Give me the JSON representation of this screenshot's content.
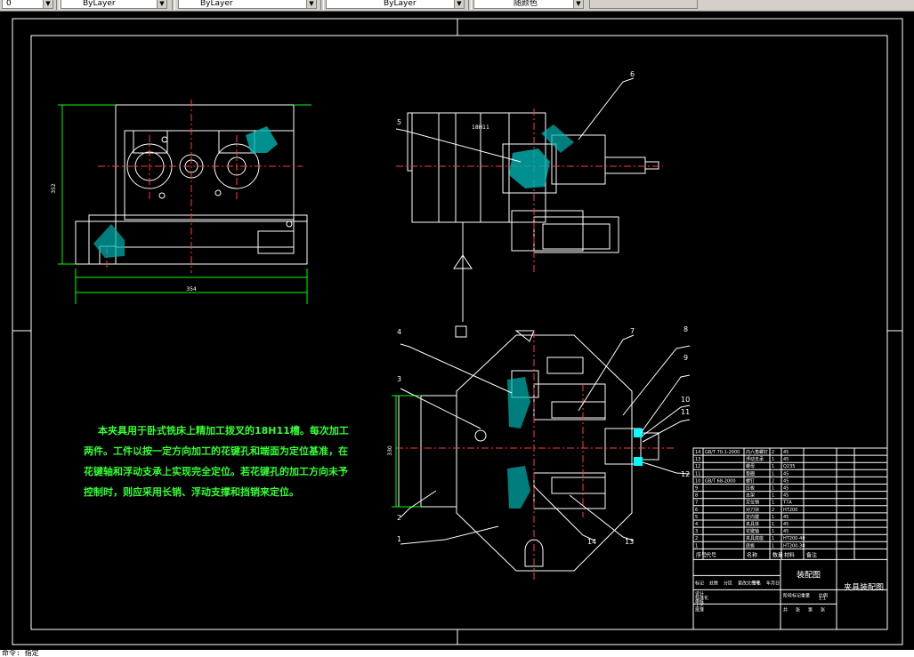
{
  "toolbar": {
    "layer_combo": "0",
    "color_combo": "ByLayer",
    "linetype_combo": "ByLayer",
    "lineweight_combo": "ByLayer",
    "plotstyle_combo": "随颜色"
  },
  "drawing": {
    "note_text_lines": [
      "本夹具用于卧式铣床上精加工拨叉的18H11槽。每次加工",
      "两件。工件以按一定方向加工的花键孔和端面为定位基准，在",
      "花键轴和浮动支承上实现完全定位。若花键孔的加工方向未予",
      "控制时，则应采用长销、浮动支撑和挡销来定位。"
    ],
    "top_view_dim_width": "354",
    "top_view_dim_height": "352",
    "front_view_dim": "18H11",
    "bottom_view_dim_height": "330",
    "balloons": [
      "1",
      "2",
      "3",
      "4",
      "5",
      "6",
      "7",
      "8",
      "9",
      "10",
      "11",
      "12",
      "13",
      "14"
    ]
  },
  "title_block": {
    "parts_rows": [
      [
        "14",
        "GB/T 70.1-2000",
        "内六角螺钉",
        "2",
        "45",
        ""
      ],
      [
        "13",
        "",
        "浮动支承",
        "1",
        "45",
        ""
      ],
      [
        "12",
        "",
        "螺母",
        "1",
        "Q235",
        ""
      ],
      [
        "11",
        "",
        "垫圈",
        "1",
        "45",
        ""
      ],
      [
        "10",
        "GB/T 68-2000",
        "螺钉",
        "2",
        "45",
        ""
      ],
      [
        "9",
        "",
        "压板",
        "1",
        "45",
        ""
      ],
      [
        "8",
        "",
        "支架",
        "1",
        "45",
        ""
      ],
      [
        "7",
        "",
        "定位销",
        "1",
        "T7A",
        ""
      ],
      [
        "6",
        "",
        "对刀块",
        "2",
        "HT200",
        ""
      ],
      [
        "5",
        "",
        "定向键",
        "1",
        "45",
        ""
      ],
      [
        "4",
        "",
        "夹具体",
        "1",
        "45",
        ""
      ],
      [
        "3",
        "",
        "花键轴",
        "1",
        "45",
        ""
      ],
      [
        "2",
        "",
        "夹具底座",
        "1",
        "HT200-40",
        ""
      ],
      [
        "1",
        "",
        "底板",
        "1",
        "HT200-30",
        ""
      ]
    ],
    "parts_header": [
      "序号",
      "代号",
      "名称",
      "数量",
      "材料",
      "备注"
    ],
    "drawing_name": "装配图",
    "drawing_title": "夹具装配图",
    "scale": "1:1",
    "labels": [
      "标记",
      "处数",
      "分区",
      "更改文件号",
      "签名",
      "年月日",
      "设计",
      "标准化",
      "审核",
      "工艺",
      "批准",
      "阶段标记",
      "重量",
      "比例",
      "共",
      "张",
      "第",
      "张"
    ]
  },
  "command_line": "命令: 指定"
}
